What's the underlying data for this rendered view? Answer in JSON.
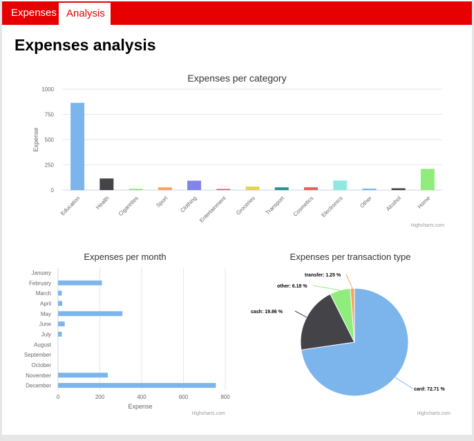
{
  "tabs": [
    {
      "label": "Expenses",
      "active": false
    },
    {
      "label": "Analysis",
      "active": true
    }
  ],
  "page_title": "Expenses analysis",
  "credits": "Highcharts.com",
  "chart_data": [
    {
      "type": "bar",
      "title": "Expenses per category",
      "ylabel": "Expense",
      "ylim": [
        0,
        1000
      ],
      "yticks": [
        0,
        250,
        500,
        750,
        1000
      ],
      "categories": [
        "Education",
        "Health",
        "Cigarettes",
        "Sport",
        "Clothing",
        "Entertainment",
        "Groceries",
        "Transport",
        "Cosmetics",
        "Electronics",
        "Other",
        "Alcohol",
        "Home"
      ],
      "values": [
        865,
        115,
        14,
        27,
        93,
        12,
        35,
        27,
        28,
        95,
        15,
        18,
        210
      ],
      "colors": [
        "#7cb5ec",
        "#434348",
        "#90ed7d",
        "#f7a35c",
        "#8085e9",
        "#f15c80",
        "#e4d354",
        "#2b908f",
        "#f45b5b",
        "#91e8e1",
        "#7cb5ec",
        "#434348",
        "#90ed7d"
      ],
      "grid": true,
      "legend": "none"
    },
    {
      "type": "bar",
      "orientation": "horizontal",
      "title": "Expenses per month",
      "xlabel": "Expense",
      "xlim": [
        0,
        800
      ],
      "xticks": [
        0,
        200,
        400,
        600,
        800
      ],
      "categories": [
        "January",
        "February",
        "March",
        "April",
        "May",
        "June",
        "July",
        "August",
        "September",
        "October",
        "November",
        "December"
      ],
      "values": [
        0,
        210,
        18,
        20,
        308,
        32,
        18,
        0,
        0,
        0,
        238,
        755
      ],
      "color": "#7cb5ec",
      "grid": true,
      "legend": "none"
    },
    {
      "type": "pie",
      "title": "Expenses per transaction type",
      "slices": [
        {
          "name": "card",
          "percent": 72.71,
          "color": "#7cb5ec",
          "label": "card: 72.71 %"
        },
        {
          "name": "cash",
          "percent": 19.86,
          "color": "#434348",
          "label": "cash: 19.86 %"
        },
        {
          "name": "other",
          "percent": 6.18,
          "color": "#90ed7d",
          "label": "other: 6.18 %"
        },
        {
          "name": "transfer",
          "percent": 1.25,
          "color": "#f7a35c",
          "label": "transfer: 1.25 %"
        }
      ],
      "legend": "none"
    }
  ]
}
